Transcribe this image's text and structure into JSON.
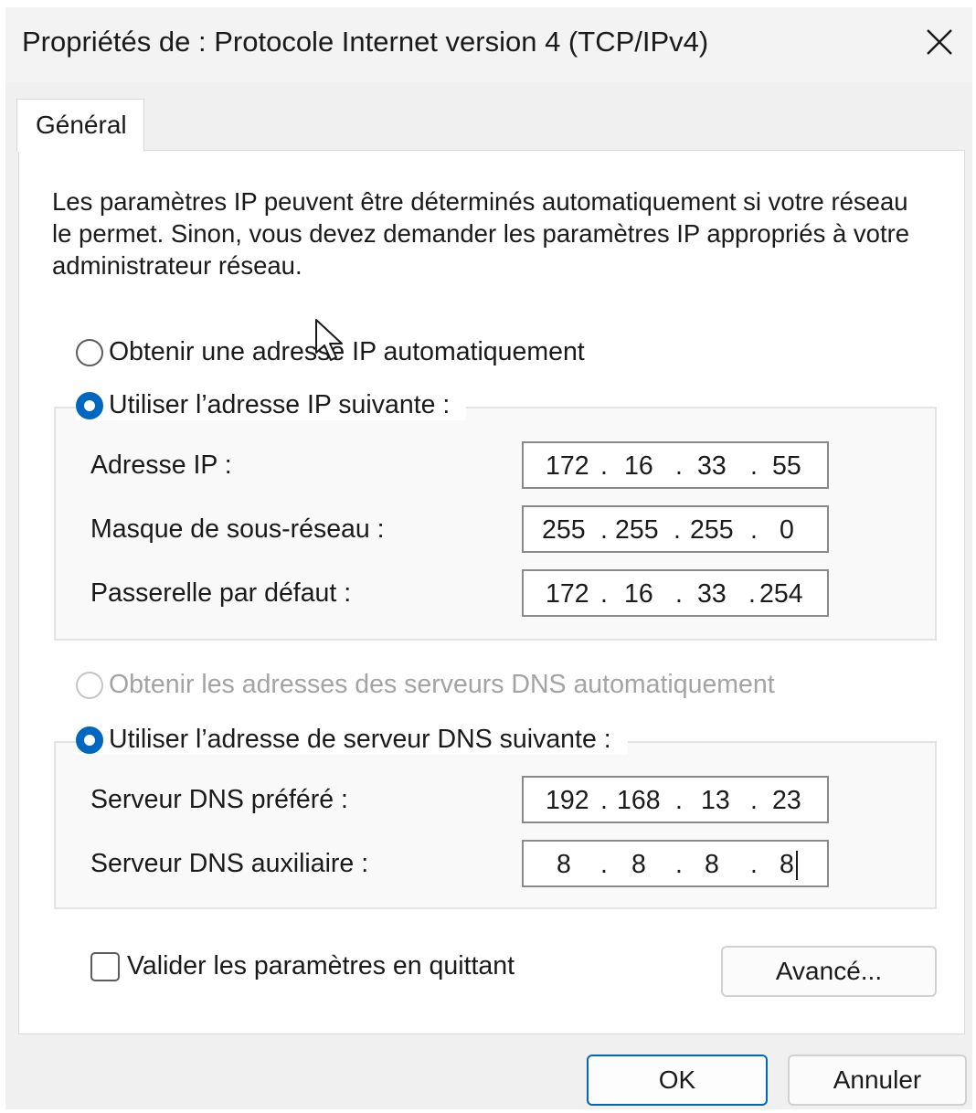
{
  "window": {
    "title": "Propriétés de : Protocole Internet version 4 (TCP/IPv4)"
  },
  "tabs": [
    {
      "label": "Général"
    }
  ],
  "intro_text": "Les paramètres IP peuvent être déterminés automatiquement si votre réseau le permet. Sinon, vous devez demander les paramètres IP appropriés à votre administrateur réseau.",
  "ip_section": {
    "auto_option": {
      "label": "Obtenir une adresse IP automatiquement",
      "selected": false
    },
    "manual_option": {
      "label": "Utiliser l’adresse IP suivante :",
      "selected": true
    },
    "fields": [
      {
        "label": "Adresse IP :",
        "octets": [
          "172",
          "16",
          "33",
          "55"
        ]
      },
      {
        "label": "Masque de sous-réseau :",
        "octets": [
          "255",
          "255",
          "255",
          "0"
        ]
      },
      {
        "label": "Passerelle par défaut :",
        "octets": [
          "172",
          "16",
          "33",
          "254"
        ]
      }
    ]
  },
  "dns_section": {
    "auto_option": {
      "label": "Obtenir les adresses des serveurs DNS automatiquement",
      "selected": false,
      "disabled": true
    },
    "manual_option": {
      "label": "Utiliser l’adresse de serveur DNS suivante :",
      "selected": true
    },
    "fields": [
      {
        "label": "Serveur DNS préféré :",
        "octets": [
          "192",
          "168",
          "13",
          "23"
        ]
      },
      {
        "label": "Serveur DNS auxiliaire :",
        "octets": [
          "8",
          "8",
          "8",
          "8"
        ]
      }
    ]
  },
  "validate_checkbox": {
    "label": "Valider les paramètres en quittant",
    "checked": false
  },
  "buttons": {
    "advanced": "Avancé...",
    "ok": "OK",
    "cancel": "Annuler"
  },
  "colors": {
    "accent": "#0067c0",
    "disabled_text": "#a3a3a3"
  },
  "icons": {
    "close": "close-icon",
    "mouse_cursor": "mouse-pointer-icon"
  }
}
